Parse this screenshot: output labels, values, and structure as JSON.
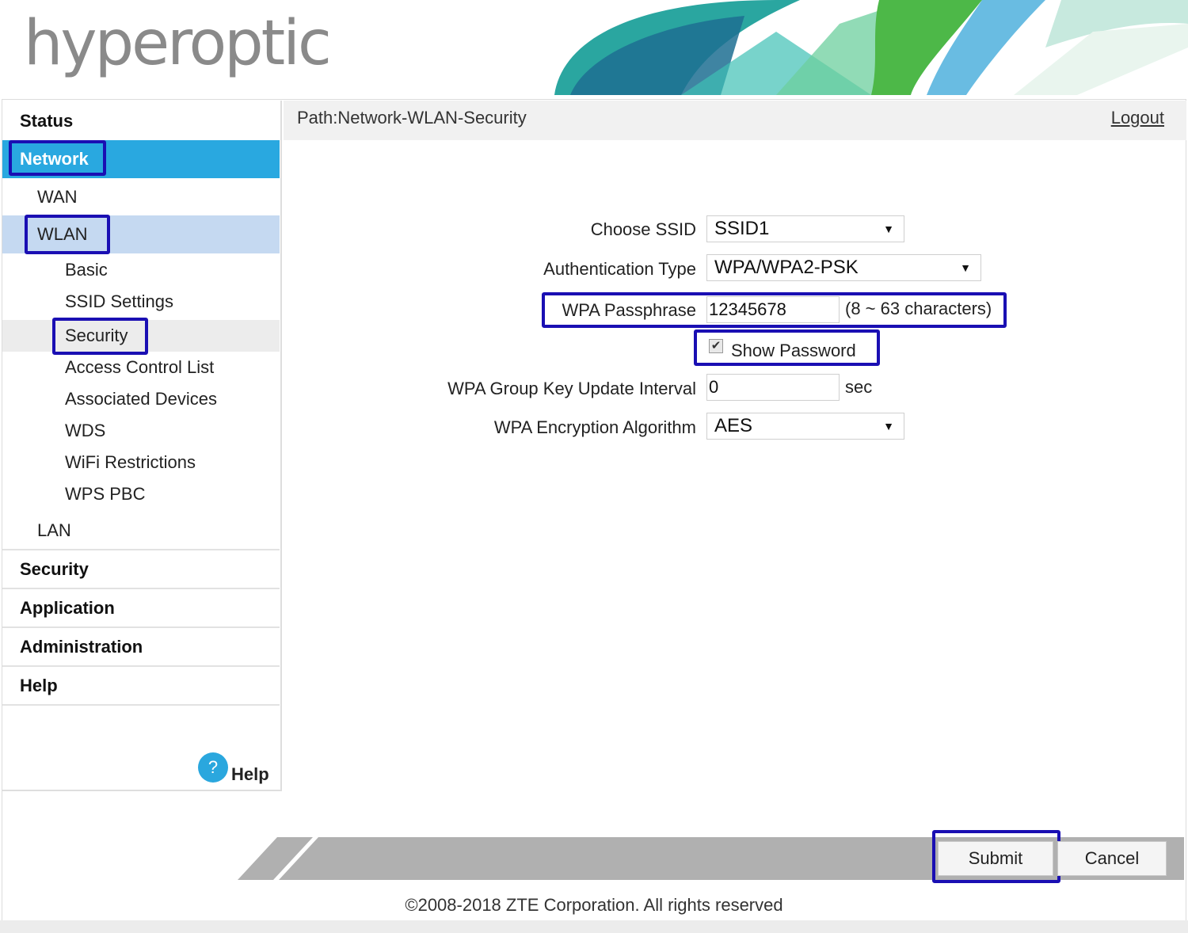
{
  "brand": {
    "logo_text": "hyperoptic"
  },
  "sidebar": {
    "status": "Status",
    "network": "Network",
    "wan": "WAN",
    "wlan": "WLAN",
    "wlan_items": [
      "Basic",
      "SSID Settings",
      "Security",
      "Access Control List",
      "Associated Devices",
      "WDS",
      "WiFi Restrictions",
      "WPS PBC"
    ],
    "lan": "LAN",
    "security": "Security",
    "application": "Application",
    "administration": "Administration",
    "help": "Help",
    "help_link": "Help",
    "help_icon": "question-icon",
    "help_icon_glyph": "?"
  },
  "pathbar": {
    "path": "Path:Network-WLAN-Security",
    "logout": "Logout"
  },
  "form": {
    "ssid_label": "Choose SSID",
    "ssid_value": "SSID1",
    "auth_label": "Authentication Type",
    "auth_value": "WPA/WPA2-PSK",
    "pass_label": "WPA Passphrase",
    "pass_value": "12345678",
    "pass_hint": "(8 ~ 63 characters)",
    "show_password_label": "Show Password",
    "show_password_checked": true,
    "rekey_label": "WPA Group Key Update Interval",
    "rekey_value": "0",
    "rekey_unit": "sec",
    "enc_label": "WPA Encryption Algorithm",
    "enc_value": "AES",
    "dropdown_glyph": "▼",
    "check_glyph": "✔"
  },
  "buttons": {
    "submit": "Submit",
    "cancel": "Cancel"
  },
  "footer": {
    "copyright": "©2008-2018 ZTE Corporation. All rights reserved"
  },
  "colors": {
    "accent": "#29a8e0",
    "wlan_selected": "#c5d9f1",
    "highlight": "#1a0fb3"
  }
}
